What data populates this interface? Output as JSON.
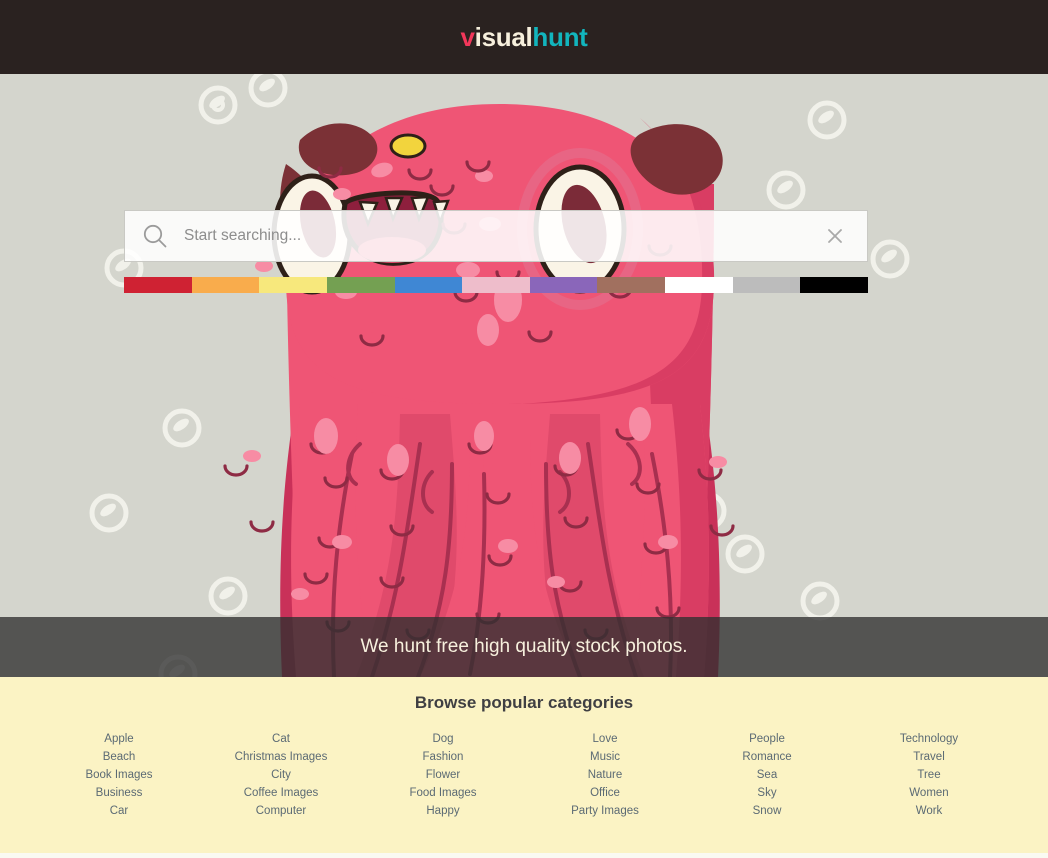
{
  "header": {
    "logo": {
      "part1": "v",
      "part2": "isual",
      "part3": "hunt"
    },
    "colors": {
      "bar": "#2a2220",
      "accent_red": "#f2375a",
      "accent_cream": "#f7f0dd",
      "accent_teal": "#12b5bd"
    }
  },
  "hero": {
    "background_color": "#d4d5cd",
    "illustration": "pink-monster-illustration",
    "search": {
      "icon": "search-icon",
      "placeholder": "Start searching...",
      "value": "",
      "clear_icon": "close-icon"
    },
    "color_filters": [
      {
        "name": "red",
        "hex": "#cf2233"
      },
      {
        "name": "orange",
        "hex": "#f9ac4c"
      },
      {
        "name": "yellow",
        "hex": "#f7e87c"
      },
      {
        "name": "green",
        "hex": "#74a052"
      },
      {
        "name": "blue",
        "hex": "#3f87d4"
      },
      {
        "name": "pink",
        "hex": "#eebdcb"
      },
      {
        "name": "purple",
        "hex": "#8a66ba"
      },
      {
        "name": "brown",
        "hex": "#a1705f"
      },
      {
        "name": "white",
        "hex": "#ffffff"
      },
      {
        "name": "gray",
        "hex": "#bcbcbc"
      },
      {
        "name": "black",
        "hex": "#000000"
      }
    ]
  },
  "tagline": {
    "text": "We hunt free high quality stock photos."
  },
  "categories": {
    "title": "Browse popular categories",
    "columns": [
      {
        "items": [
          "Apple",
          "Beach",
          "Book Images",
          "Business",
          "Car"
        ]
      },
      {
        "items": [
          "Cat",
          "Christmas Images",
          "City",
          "Coffee Images",
          "Computer"
        ]
      },
      {
        "items": [
          "Dog",
          "Fashion",
          "Flower",
          "Food Images",
          "Happy"
        ]
      },
      {
        "items": [
          "Love",
          "Music",
          "Nature",
          "Office",
          "Party Images"
        ]
      },
      {
        "items": [
          "People",
          "Romance",
          "Sea",
          "Sky",
          "Snow"
        ]
      },
      {
        "items": [
          "Technology",
          "Travel",
          "Tree",
          "Women",
          "Work"
        ]
      }
    ]
  }
}
